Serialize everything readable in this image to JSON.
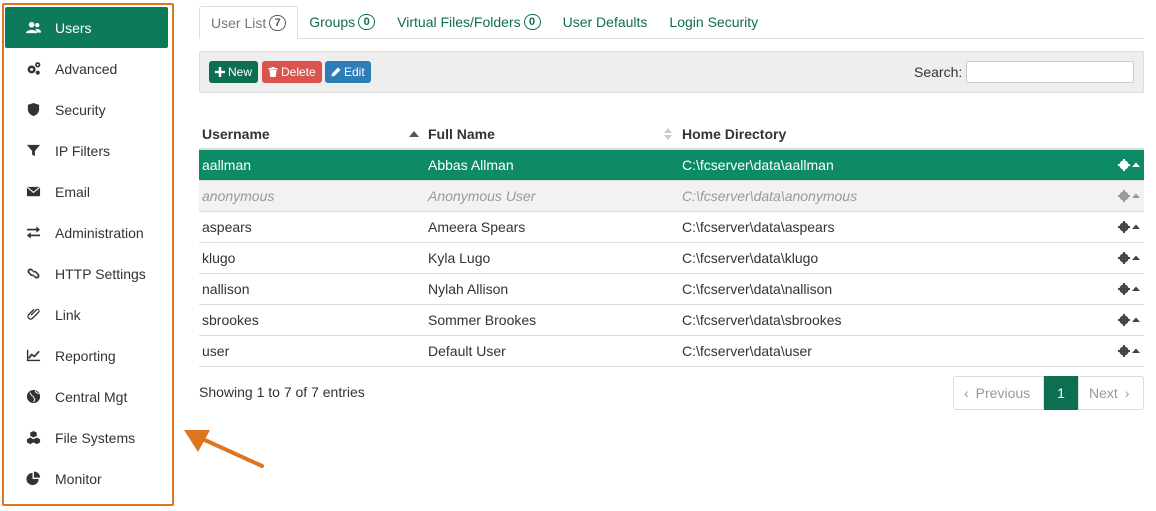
{
  "sidebar": {
    "items": [
      {
        "label": "Users",
        "icon": "users-icon",
        "active": true
      },
      {
        "label": "Advanced",
        "icon": "gears-icon"
      },
      {
        "label": "Security",
        "icon": "shield-icon"
      },
      {
        "label": "IP Filters",
        "icon": "filter-icon"
      },
      {
        "label": "Email",
        "icon": "envelope-icon"
      },
      {
        "label": "Administration",
        "icon": "exchange-arrows-icon"
      },
      {
        "label": "HTTP Settings",
        "icon": "link-chain-icon"
      },
      {
        "label": "Link",
        "icon": "paperclip-icon"
      },
      {
        "label": "Reporting",
        "icon": "line-chart-icon"
      },
      {
        "label": "Central Mgt",
        "icon": "globe-icon"
      },
      {
        "label": "File Systems",
        "icon": "cubes-icon"
      },
      {
        "label": "Monitor",
        "icon": "pie-chart-icon"
      }
    ]
  },
  "tabs": [
    {
      "label": "User List",
      "count": "7",
      "active": true
    },
    {
      "label": "Groups",
      "count": "0"
    },
    {
      "label": "Virtual Files/Folders",
      "count": "0"
    },
    {
      "label": "User Defaults"
    },
    {
      "label": "Login Security"
    }
  ],
  "toolbar": {
    "new_label": "New",
    "delete_label": "Delete",
    "edit_label": "Edit",
    "search_label": "Search:",
    "search_value": ""
  },
  "table": {
    "columns": [
      "Username",
      "Full Name",
      "Home Directory"
    ],
    "rows": [
      {
        "username": "aallman",
        "full_name": "Abbas Allman",
        "home": "C:\\fcserver\\data\\aallman",
        "state": "selected"
      },
      {
        "username": "anonymous",
        "full_name": "Anonymous User",
        "home": "C:\\fcserver\\data\\anonymous",
        "state": "disabled"
      },
      {
        "username": "aspears",
        "full_name": "Ameera Spears",
        "home": "C:\\fcserver\\data\\aspears",
        "state": ""
      },
      {
        "username": "klugo",
        "full_name": "Kyla Lugo",
        "home": "C:\\fcserver\\data\\klugo",
        "state": ""
      },
      {
        "username": "nallison",
        "full_name": "Nylah Allison",
        "home": "C:\\fcserver\\data\\nallison",
        "state": ""
      },
      {
        "username": "sbrookes",
        "full_name": "Sommer Brookes",
        "home": "C:\\fcserver\\data\\sbrookes",
        "state": ""
      },
      {
        "username": "user",
        "full_name": "Default User",
        "home": "C:\\fcserver\\data\\user",
        "state": ""
      }
    ]
  },
  "footer": {
    "info": "Showing 1 to 7 of 7 entries",
    "prev_label": "Previous",
    "current_page": "1",
    "next_label": "Next"
  },
  "colors": {
    "accent": "#0d7a5c",
    "selected_row": "#0d8a66",
    "delete": "#d9534f",
    "edit": "#2e7db7",
    "callout": "#e0751f"
  }
}
